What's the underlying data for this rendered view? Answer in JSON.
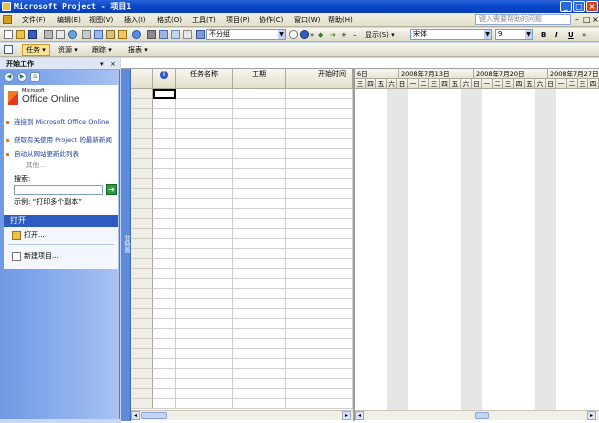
{
  "title": "Microsoft Project - 项目1",
  "menu": [
    "文件(F)",
    "编辑(E)",
    "视图(V)",
    "插入(I)",
    "格式(O)",
    "工具(T)",
    "项目(P)",
    "协作(C)",
    "窗口(W)",
    "帮助(H)"
  ],
  "help_placeholder": "键入需要帮助的问题",
  "toolbar1": {
    "group_combo": "不分组"
  },
  "toolbar2": {
    "show_label": "显示(S)",
    "font_combo": "宋体",
    "size_combo": "9",
    "bold": "B",
    "italic": "I",
    "underline": "U"
  },
  "toolbar3": {
    "tasks": "任务",
    "resources": "资源",
    "track": "跟踪",
    "report": "报表"
  },
  "pane": {
    "title": "开始工作",
    "office_brand_small": "Microsoft",
    "office_brand": "Office Online",
    "links": [
      "连接到 Microsoft Office Online",
      "获取有关使用 Project 的最新新闻",
      "自动从网站更新此列表"
    ],
    "more": "其他...",
    "search_label": "搜索:",
    "example": "示例: “打印多个副本”",
    "open_section": "打开",
    "open_item": "打开...",
    "new_item": "新建项目..."
  },
  "table": {
    "info_col": "i",
    "col_name": "任务名称",
    "col_duration": "工期",
    "col_start": "开始时间"
  },
  "gantt_vertical_label": "甘特图",
  "gantt": {
    "weeks": [
      "6日",
      "2008年7月13日",
      "2008年7月20日",
      "2008年7月27日"
    ],
    "days": [
      "三",
      "四",
      "五",
      "六",
      "日",
      "一",
      "二",
      "三",
      "四",
      "五",
      "六",
      "日",
      "一",
      "二",
      "三",
      "四",
      "五",
      "六",
      "日",
      "一",
      "二",
      "三",
      "四"
    ]
  },
  "colors": {
    "titlebar": "#0846c8",
    "pane": "#8fb1ee",
    "section": "#2d5cc1"
  }
}
